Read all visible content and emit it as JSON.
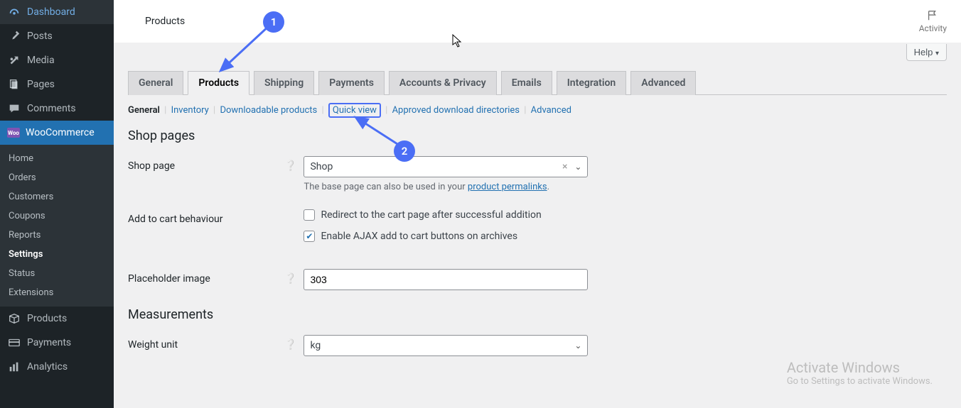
{
  "sidebar": {
    "items": [
      {
        "icon": "dashboard",
        "label": "Dashboard"
      },
      {
        "icon": "pin",
        "label": "Posts"
      },
      {
        "icon": "media",
        "label": "Media"
      },
      {
        "icon": "page",
        "label": "Pages"
      },
      {
        "icon": "comment",
        "label": "Comments"
      }
    ],
    "woo_label": "WooCommerce",
    "woo_sub": [
      "Home",
      "Orders",
      "Customers",
      "Coupons",
      "Reports",
      "Settings",
      "Status",
      "Extensions"
    ],
    "woo_sub_current": "Settings",
    "after": [
      {
        "icon": "box",
        "label": "Products"
      },
      {
        "icon": "card",
        "label": "Payments"
      },
      {
        "icon": "chart",
        "label": "Analytics"
      }
    ]
  },
  "topbar": {
    "title": "Products",
    "activity_label": "Activity"
  },
  "help_label": "Help",
  "tabs": [
    "General",
    "Products",
    "Shipping",
    "Payments",
    "Accounts & Privacy",
    "Emails",
    "Integration",
    "Advanced"
  ],
  "tabs_active": "Products",
  "subsub": {
    "current": "General",
    "links": [
      "Inventory",
      "Downloadable products",
      "Quick view",
      "Approved download directories",
      "Advanced"
    ],
    "highlight": "Quick view"
  },
  "sections": {
    "shop_pages_heading": "Shop pages",
    "shop_page_label": "Shop page",
    "shop_page_value": "Shop",
    "shop_page_desc_prefix": "The base page can also be used in your ",
    "shop_page_desc_link": "product permalinks",
    "shop_page_desc_suffix": ".",
    "add_to_cart_label": "Add to cart behaviour",
    "redirect_label": "Redirect to the cart page after successful addition",
    "ajax_label": "Enable AJAX add to cart buttons on archives",
    "redirect_checked": false,
    "ajax_checked": true,
    "placeholder_label": "Placeholder image",
    "placeholder_value": "303",
    "measurements_heading": "Measurements",
    "weight_label": "Weight unit",
    "weight_value": "kg"
  },
  "annotations": {
    "circle1": "1",
    "circle2": "2"
  },
  "watermark": {
    "line1": "Activate Windows",
    "line2": "Go to Settings to activate Windows."
  }
}
